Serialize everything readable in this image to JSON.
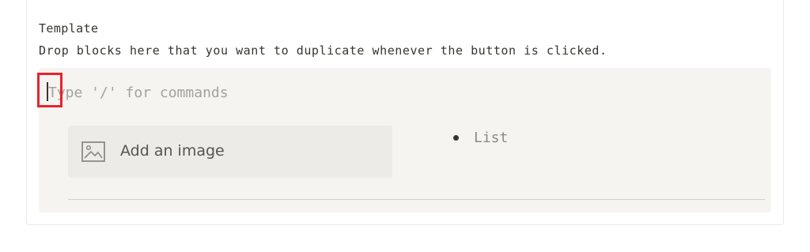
{
  "template": {
    "label": "Template",
    "description": "Drop blocks here that you want to duplicate whenever the button is clicked.",
    "command_input": {
      "value": "",
      "placeholder": "Type '/' for commands"
    },
    "image_block": {
      "icon": "image-icon",
      "label": "Add an image"
    },
    "list_item": {
      "icon": "bullet-icon",
      "label": "List"
    }
  },
  "colors": {
    "text": "#37352f",
    "placeholder": "#a4a29d",
    "template_background": "#f5f4f1",
    "image_block_background": "#ecebe8",
    "highlight": "#e8232d"
  }
}
